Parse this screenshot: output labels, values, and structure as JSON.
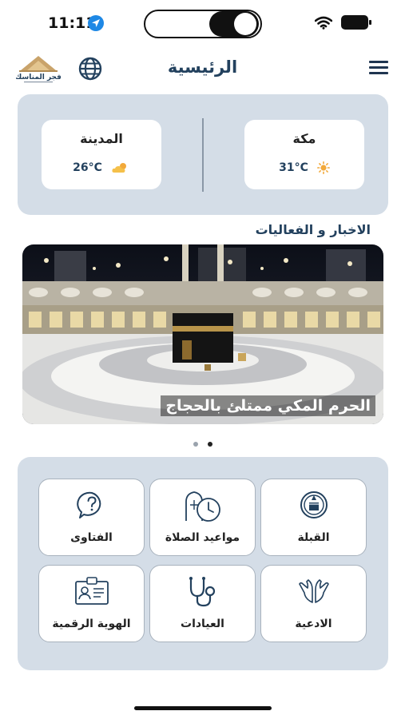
{
  "status_bar": {
    "time": "11:11"
  },
  "header": {
    "title": "الرئيسية",
    "logo_text": "فجر المناسك"
  },
  "weather": {
    "cities": [
      {
        "name": "مكة",
        "temp": "31°C",
        "icon": "sun-icon"
      },
      {
        "name": "المدينة",
        "temp": "26°C",
        "icon": "cloud-sun-icon"
      }
    ]
  },
  "news": {
    "heading": "الاخبار و الفعاليات",
    "slides": [
      {
        "caption": "الحرم المكي ممتلئ بالحجاج"
      }
    ],
    "active_slide": 2,
    "slide_count": 2
  },
  "services": [
    {
      "label": "القبلة",
      "icon": "qibla-icon"
    },
    {
      "label": "مواعيد الصلاة",
      "icon": "prayer-times-icon"
    },
    {
      "label": "الفتاوى",
      "icon": "fatwa-icon"
    },
    {
      "label": "الادعية",
      "icon": "dua-icon"
    },
    {
      "label": "العيادات",
      "icon": "clinics-icon"
    },
    {
      "label": "الهوية الرقمية",
      "icon": "digital-id-icon"
    }
  ],
  "colors": {
    "accent": "#23415e",
    "panel": "#d4dde7"
  }
}
